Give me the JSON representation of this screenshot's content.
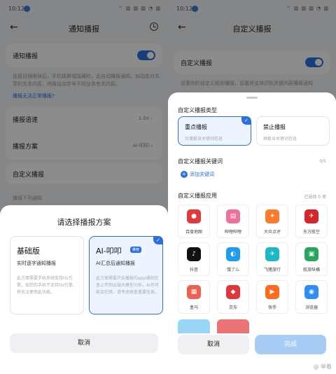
{
  "status": {
    "time": "10:12",
    "indicators": "⌔ ▥ ▥ ▥ ◔ ▥"
  },
  "left": {
    "nav_title": "通知播报",
    "notify_label": "通知播报",
    "desc": "连接目镜眼镜后，手机锁屏或隐藏时，会自动播报通知。如动态对共享的文本内容，将报自动学号不同业务有关内容。",
    "link": "播报无法正常播报?",
    "rows": [
      {
        "label": "播报语速",
        "value": "1.0x ›"
      },
      {
        "label": "播报方案",
        "value": "AI-叩叩 ›"
      }
    ],
    "custom_label": "自定义播报",
    "below_label": "播报下列通知",
    "sheet": {
      "title": "请选择播报方案",
      "plans": [
        {
          "name": "基础版",
          "sub": "实时逐字通知播报",
          "desc": "此方案需要手机系统支持tts引擎，如您的手机不支持tts引擎，将无法使用此功能。",
          "selected": false
        },
        {
          "name": "AI-叩叩",
          "badge": "推荐",
          "sub": "AI汇总后通知播报",
          "desc": "此方案需要开启播报的app通知信息上传到云端大模型分析。AI也可能会犯错，请考虑核查重要信息。",
          "selected": true
        }
      ],
      "cancel": "取消"
    }
  },
  "right": {
    "nav_title": "自定义播报",
    "custom_label": "自定义播报",
    "desc": "设置你的自定义规则播报，设置将支持识别关键内容播报通知",
    "sheet": {
      "type_section": "自定义播报类型",
      "types": [
        {
          "name": "重点播报",
          "desc": "仅播报含关键词信息",
          "selected": true
        },
        {
          "name": "禁止播报",
          "desc": "屏蔽含关键词信息",
          "selected": false
        }
      ],
      "keyword_section": "自定义播报关键词",
      "keyword_count": "0/5",
      "add_keyword": "添加关键词",
      "app_section": "自定义播报应用",
      "app_count": "已选择 0 项",
      "apps": [
        {
          "label": "百度地图",
          "color": "#e4393c",
          "glyph": "●"
        },
        {
          "label": "哔哩哔哩",
          "color": "#f0709a",
          "glyph": "▤"
        },
        {
          "label": "大众点评",
          "color": "#ff7a2a",
          "glyph": "✦"
        },
        {
          "label": "东方航空",
          "color": "#d7252c",
          "glyph": "✈"
        },
        {
          "label": "抖音",
          "color": "#111111",
          "glyph": "♪"
        },
        {
          "label": "饿了么",
          "color": "#1e9cf0",
          "glyph": "◐"
        },
        {
          "label": "飞猪旅行",
          "color": "#1bb8c7",
          "glyph": "✈"
        },
        {
          "label": "航旅纵横",
          "color": "#27a55b",
          "glyph": "▣"
        },
        {
          "label": "盒马",
          "color": "#f06050",
          "glyph": "▦"
        },
        {
          "label": "京东",
          "color": "#e3363a",
          "glyph": "◆"
        },
        {
          "label": "快手",
          "color": "#ff6a1f",
          "glyph": "▶"
        },
        {
          "label": "浏览器",
          "color": "#2e8ef5",
          "glyph": "◉"
        }
      ],
      "cancel": "取消",
      "done": "完成"
    },
    "watermark": "@ 举着"
  }
}
